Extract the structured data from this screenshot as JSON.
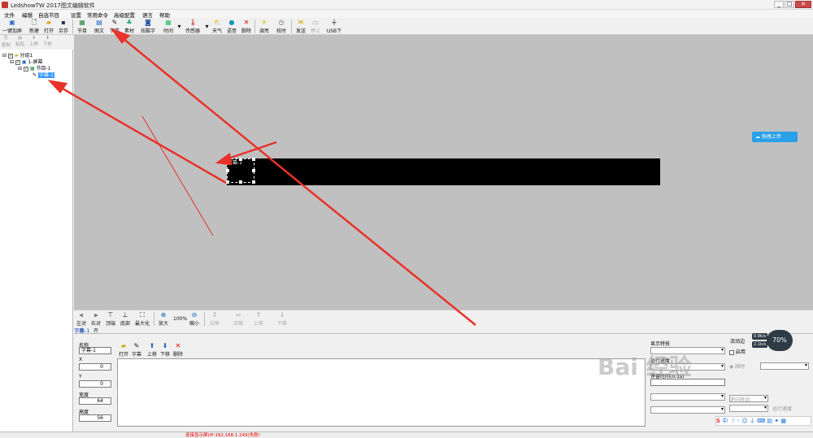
{
  "window": {
    "title": "LedshowTW 2017图文编辑软件",
    "buttons": [
      "_",
      "□",
      "✕"
    ]
  },
  "menubar": [
    "文件",
    "编辑",
    "自选节目",
    "设置",
    "常用命令",
    "高级配置",
    "语言",
    "帮助"
  ],
  "toolbar": {
    "left_buttons": [
      {
        "label": "一键加屏",
        "icon": "add-screen-icon"
      },
      {
        "label": "新建",
        "icon": "new-file-icon"
      },
      {
        "label": "打开",
        "icon": "open-folder-icon"
      },
      {
        "label": "另存",
        "icon": "save-icon"
      }
    ],
    "main_buttons": [
      {
        "label": "节目",
        "icon": "program-icon"
      },
      {
        "label": "图文",
        "icon": "image-text-icon"
      },
      {
        "label": "字幕",
        "icon": "subtitle-icon"
      },
      {
        "label": "素材",
        "icon": "material-icon"
      },
      {
        "label": "炫酷字",
        "icon": "cool-text-icon"
      },
      {
        "label": "时间",
        "icon": "clock-icon"
      },
      {
        "label": "传感器",
        "icon": "sensor-icon"
      },
      {
        "label": "天气",
        "icon": "weather-icon"
      },
      {
        "label": "语音",
        "icon": "voice-icon"
      },
      {
        "label": "删除",
        "icon": "delete-icon"
      },
      {
        "label": "调亮",
        "icon": "brightness-icon"
      },
      {
        "label": "校时",
        "icon": "time-sync-icon"
      },
      {
        "label": "发送",
        "icon": "send-icon"
      },
      {
        "label": "停止",
        "icon": "stop-icon"
      },
      {
        "label": "USB下载",
        "icon": "usb-icon"
      }
    ]
  },
  "left_tools": [
    "复制",
    "粘贴",
    "上移",
    "下移"
  ],
  "tree": {
    "group": "分组1",
    "screen": "1-屏幕",
    "program": "节目-1",
    "item": "字幕-1"
  },
  "canvas": {
    "layer_label": "字幕-1",
    "upload_button": "拖拽上传"
  },
  "align_tools": [
    "左对齐",
    "右对齐",
    "顶端",
    "底部",
    "最大化",
    "放大",
    "100%",
    "缩小",
    "拉伸",
    "压缩",
    "上移",
    "下移"
  ],
  "selection_title": "字幕-1",
  "props": {
    "name_label": "名称",
    "name_value": "字幕-1",
    "x_label": "X",
    "x_value": "0",
    "y_label": "Y",
    "y_value": "0",
    "width_label": "宽度",
    "width_value": "64",
    "height_label": "高度",
    "height_value": "56"
  },
  "editor_tools": [
    {
      "label": "打开",
      "icon": "open-icon"
    },
    {
      "label": "字幕",
      "icon": "subtitle-icon"
    },
    {
      "label": "上移",
      "icon": "up-arrow-icon"
    },
    {
      "label": "下移",
      "icon": "down-arrow-icon"
    },
    {
      "label": "删除",
      "icon": "delete-icon"
    }
  ],
  "effects": {
    "display_label": "显示特技",
    "speed_label": "运行速度",
    "stay_label": "停留时间(0.1s)",
    "dynamic_label": "流动边",
    "enable_label": "启用",
    "clockwise_label": "顺时",
    "counter_label": "逆向转动",
    "run_speed_label": "运行速度"
  },
  "speed_widget": {
    "up": "0.9k/s",
    "down": "2.1k/s",
    "percent": "70%"
  },
  "status": "连接显示屏(IP:192.168.1.249)失败!",
  "watermark": "Bai 经验"
}
